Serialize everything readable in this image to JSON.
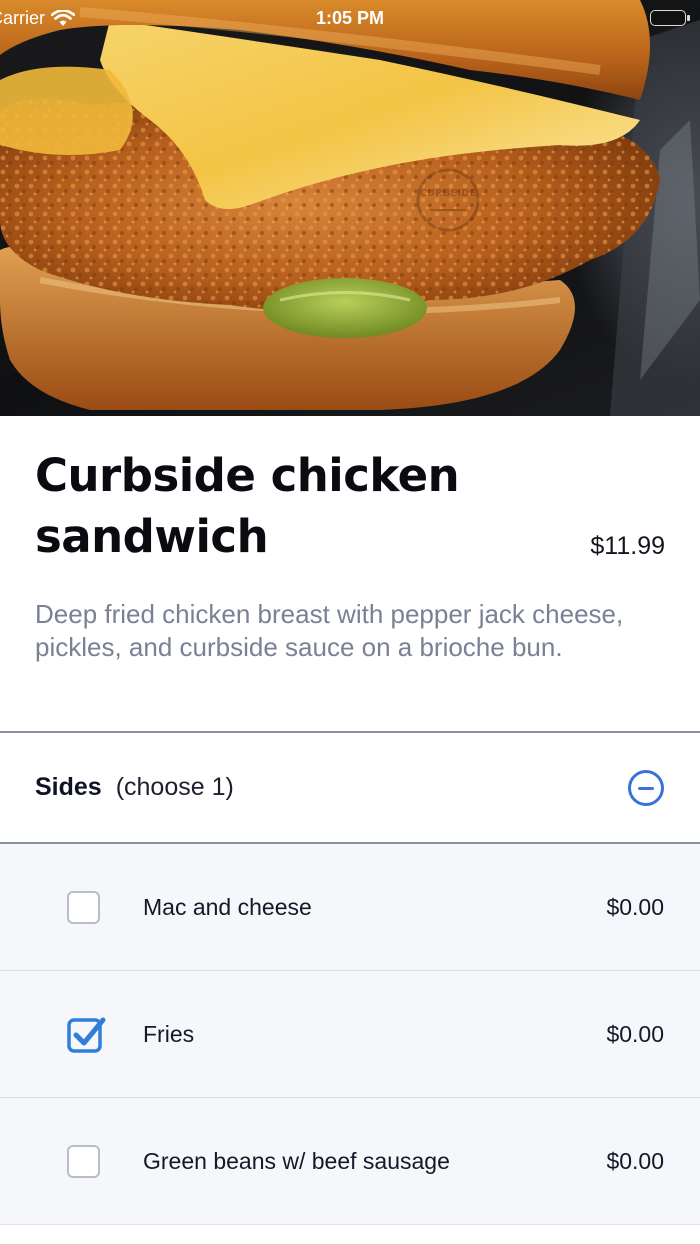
{
  "status_bar": {
    "carrier": "Carrier",
    "time": "1:05 PM"
  },
  "hero": {
    "image_subject": "Fried chicken sandwich with cheese and pickles on brioche bun",
    "watermark_text": "CURBSIDE"
  },
  "item": {
    "title": "Curbside chicken sandwich",
    "price": "$11.99",
    "description": "Deep fried chicken breast with pepper jack cheese, pickles, and curbside sauce on a brioche bun."
  },
  "sides": {
    "title": "Sides",
    "subtitle": "(choose 1)",
    "collapse_icon": "minus-circle-icon",
    "options": [
      {
        "label": "Mac and cheese",
        "price": "$0.00",
        "checked": false
      },
      {
        "label": "Fries",
        "price": "$0.00",
        "checked": true
      },
      {
        "label": "Green beans w/ beef sausage",
        "price": "$0.00",
        "checked": false
      }
    ]
  },
  "colors": {
    "accent": "#3a73d8",
    "checkbox_checked": "#2f7fd9",
    "description_text": "#7a8197",
    "options_background": "#f6f7fb"
  }
}
